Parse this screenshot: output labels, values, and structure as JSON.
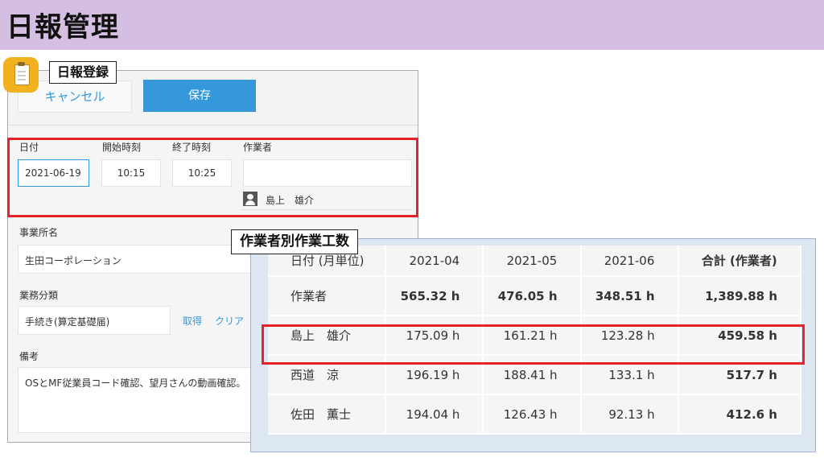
{
  "page": {
    "title": "日報管理"
  },
  "form": {
    "callout": "日報登録",
    "cancel_label": "キャンセル",
    "save_label": "保存",
    "labels": {
      "date": "日付",
      "start_time": "開始時刻",
      "end_time": "終了時刻",
      "worker": "作業者",
      "office": "事業所名",
      "category": "業務分類",
      "notes": "備考"
    },
    "values": {
      "date": "2021-06-19",
      "start_time": "10:15",
      "end_time": "10:25",
      "worker": "",
      "worker_selected": "島上　雄介",
      "office": "生田コーポレーション",
      "category": "手続き(算定基礎届)",
      "notes": "OSとMF従業員コード確認、望月さんの動画確認。"
    },
    "category_links": {
      "fetch": "取得",
      "clear": "クリア"
    }
  },
  "summary": {
    "callout": "作業者別作業工数",
    "headers": [
      "日付 (月単位)",
      "2021-04",
      "2021-05",
      "2021-06",
      "合計 (作業者)"
    ],
    "rows": [
      {
        "name": "作業者",
        "values": [
          "565.32 h",
          "476.05 h",
          "348.51 h"
        ],
        "total": "1,389.88 h"
      },
      {
        "name": "島上　雄介",
        "values": [
          "175.09 h",
          "161.21 h",
          "123.28 h"
        ],
        "total": "459.58 h"
      },
      {
        "name": "西道　涼",
        "values": [
          "196.19 h",
          "188.41 h",
          "133.1 h"
        ],
        "total": "517.7 h"
      },
      {
        "name": "佐田　薫士",
        "values": [
          "194.04 h",
          "126.43 h",
          "92.13 h"
        ],
        "total": "412.6 h"
      }
    ]
  },
  "colors": {
    "title_bar": "#d4bfe3",
    "accent": "#3498db",
    "highlight": "#e8222a",
    "summary_bg": "#dde7f2"
  },
  "icons": {
    "app": "clipboard-icon",
    "user": "user-icon"
  }
}
